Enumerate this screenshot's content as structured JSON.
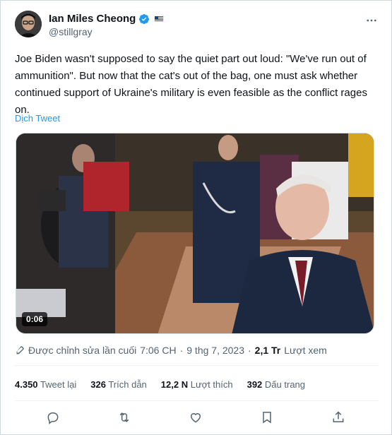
{
  "author": {
    "name": "Ian Miles Cheong",
    "handle": "@stillgray",
    "verified_icon": "verified-badge-icon",
    "flag_icon": "flag-icon"
  },
  "tweet": {
    "text": "Joe Biden wasn't supposed to say the quiet part out loud: \"We've run out of ammunition\". But now that the cat's out of the bag, one must ask whether continued support of Ukraine's military is even feasible as the conflict rages on.",
    "translate_label": "Dịch Tweet"
  },
  "media": {
    "duration": "0:06"
  },
  "meta": {
    "edit_icon": "pencil-icon",
    "edited_label": "Được chỉnh sửa lần cuối",
    "time": "7:06 CH",
    "separator": "·",
    "date": "9 thg 7, 2023",
    "views_count": "2,1 Tr",
    "views_label": "Lượt xem"
  },
  "stats": {
    "retweets_count": "4.350",
    "retweets_label": "Tweet lại",
    "quotes_count": "326",
    "quotes_label": "Trích dẫn",
    "likes_count": "12,2 N",
    "likes_label": "Lượt thích",
    "bookmarks_count": "392",
    "bookmarks_label": "Dấu trang"
  },
  "actions": [
    "reply-icon",
    "retweet-icon",
    "like-icon",
    "bookmark-icon",
    "share-icon"
  ],
  "colors": {
    "accent": "#1d9bf0",
    "text": "#0f1419",
    "secondary": "#536471",
    "border": "#cfd9de"
  }
}
